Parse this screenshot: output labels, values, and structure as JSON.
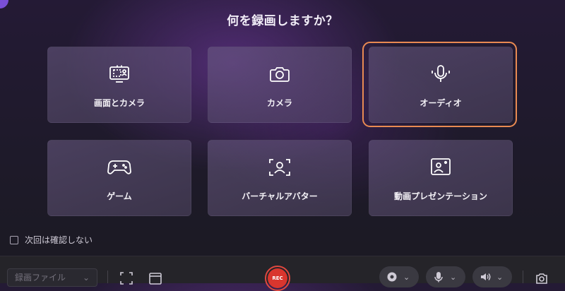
{
  "header": {
    "title": "何を録画しますか？"
  },
  "cards": [
    {
      "label": "画面とカメラ",
      "icon": "screen-camera-icon"
    },
    {
      "label": "カメラ",
      "icon": "camera-icon"
    },
    {
      "label": "オーディオ",
      "icon": "microphone-icon",
      "selected": true
    },
    {
      "label": "ゲーム",
      "icon": "gamepad-icon"
    },
    {
      "label": "バーチャルアバター",
      "icon": "avatar-icon"
    },
    {
      "label": "動画プレゼンテーション",
      "icon": "presentation-icon"
    }
  ],
  "options": {
    "dont_ask_label": "次回は確認しない",
    "dont_ask_checked": false
  },
  "toolbar": {
    "file_select_value": "録画ファイル",
    "rec_label": "REC",
    "accent_color": "#e98a52",
    "rec_color": "#d9362e"
  }
}
